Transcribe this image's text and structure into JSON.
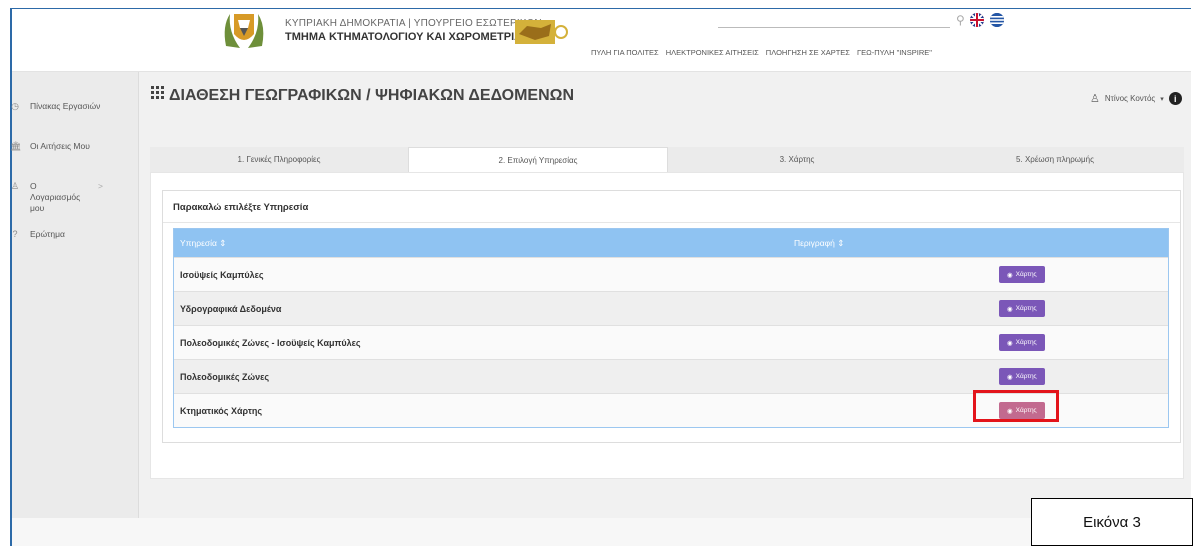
{
  "header": {
    "logo_line1": "ΚΥΠΡΙΑΚΗ ΔΗΜΟΚΡΑΤΙΑ | ΥΠΟΥΡΓΕΙΟ ΕΣΩΤΕΡΙΚΩΝ",
    "logo_line2": "ΤΜΗΜΑ ΚΤΗΜΑΤΟΛΟΓΙΟΥ ΚΑΙ ΧΩΡΟΜΕΤΡΙΑΣ",
    "top_links": [
      "ΠΥΛΗ ΓΙΑ ΠΟΛΙΤΕΣ",
      "ΗΛΕΚΤΡΟΝΙΚΕΣ ΑΙΤΗΣΕΙΣ",
      "ΠΛΟΗΓΗΣΗ ΣΕ ΧΑΡΤΕΣ",
      "ΓΕΩ-ΠΥΛΗ \"INSPIRE\""
    ]
  },
  "sidebar": {
    "items": [
      {
        "icon": "clock-icon",
        "label": "Πίνακας Εργασιών"
      },
      {
        "icon": "bank-icon",
        "label": "Οι Αιτήσεις Μου"
      },
      {
        "icon": "user-icon",
        "label": "Ο Λογαριασμός μου",
        "arrow": ">"
      },
      {
        "icon": "question-icon",
        "label": "Ερώτημα"
      }
    ]
  },
  "page": {
    "title": "ΔΙΑΘΕΣΗ ΓΕΩΓΡΑΦΙΚΩΝ / ΨΗΦΙΑΚΩΝ ΔΕΔΟΜΕΝΩΝ",
    "user_name": "Ντίνος Κοντός"
  },
  "tabs": [
    {
      "label": "1. Γενικές Πληροφορίες",
      "active": false
    },
    {
      "label": "2. Επιλογή Υπηρεσίας",
      "active": true
    },
    {
      "label": "3. Χάρτης",
      "active": false
    },
    {
      "label": "5. Χρέωση πληρωμής",
      "active": false
    }
  ],
  "card": {
    "heading": "Παρακαλώ επιλέξτε Υπηρεσία"
  },
  "table": {
    "columns": [
      "Υπηρεσία ⇕",
      "Περιγραφή ⇕"
    ],
    "rows": [
      {
        "service": "Ισοϋψείς Καμπύλες",
        "description": "",
        "button": "Χάρτης"
      },
      {
        "service": "Υδρογραφικά Δεδομένα",
        "description": "",
        "button": "Χάρτης"
      },
      {
        "service": "Πολεοδομικές Ζώνες - Ισοϋψείς Καμπύλες",
        "description": "",
        "button": "Χάρτης"
      },
      {
        "service": "Πολεοδομικές Ζώνες",
        "description": "",
        "button": "Χάρτης"
      },
      {
        "service": "Κτηματικός Χάρτης",
        "description": "",
        "button": "Χάρτης"
      }
    ]
  },
  "caption": "Εικόνα 3",
  "colors": {
    "accent_purple": "#7b57b8",
    "highlight_red": "#e3141b",
    "table_header": "#8fc3f2"
  }
}
